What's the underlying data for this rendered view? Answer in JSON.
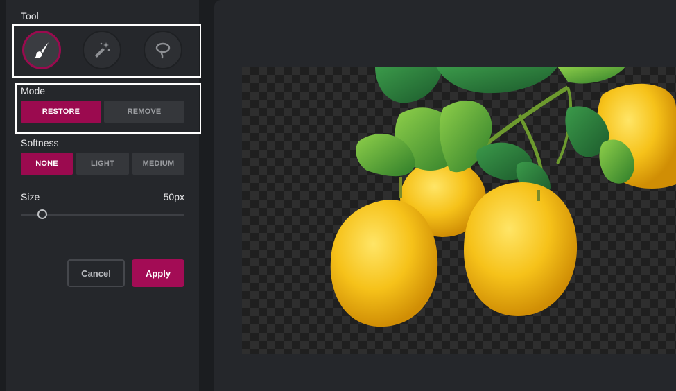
{
  "panel": {
    "tool_label": "Tool",
    "tools": [
      {
        "name": "brush",
        "icon": "paintbrush-icon",
        "active": true
      },
      {
        "name": "magic-wand",
        "icon": "magic-wand-icon",
        "active": false
      },
      {
        "name": "lasso",
        "icon": "lasso-icon",
        "active": false
      }
    ],
    "mode_label": "Mode",
    "mode_options": [
      "RESTORE",
      "REMOVE"
    ],
    "mode_selected": "RESTORE",
    "softness_label": "Softness",
    "softness_options": [
      "NONE",
      "LIGHT",
      "MEDIUM"
    ],
    "softness_selected": "NONE",
    "size_label": "Size",
    "size_value": "50px",
    "size_slider_fraction": 0.13,
    "cancel_label": "Cancel",
    "apply_label": "Apply"
  },
  "colors": {
    "accent": "#9b0a4f",
    "panel_bg": "#25272b",
    "app_bg": "#1b1d20"
  },
  "canvas": {
    "image": "lemons-on-branch",
    "background": "transparency-checkerboard"
  }
}
